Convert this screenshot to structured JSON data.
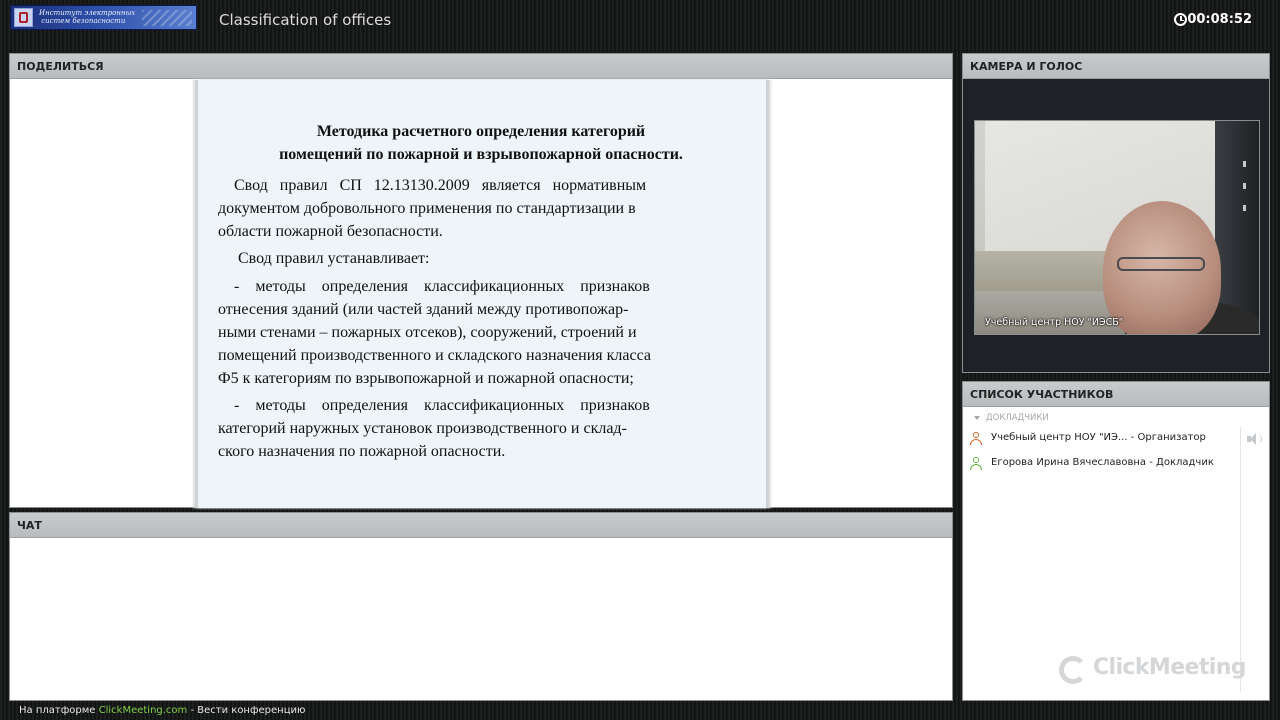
{
  "header": {
    "logo_text": "Институт электронных\n систем безопасности",
    "title": "Classification of offices",
    "timer": "00:08:52"
  },
  "share_panel": {
    "title": "ПОДЕЛИТЬСЯ",
    "slide": {
      "heading": "Методика расчетного определения категорий\nпомещений по пожарной и взрывопожарной опасности.",
      "paragraphs": [
        "    Свод   правил   СП   12.13130.2009   является   нормативным\nдокументом добровольного применения по стандартизации в\nобласти пожарной безопасности.",
        "     Свод правил устанавливает:",
        "    -    методы    определения    классификационных    признаков\nотнесения зданий (или частей зданий между противопожар-\nными стенами – пожарных отсеков), сооружений, строений и\nпомещений производственного и складского назначения класса\nФ5 к категориям по взрывопожарной и пожарной опасности;",
        "    -    методы    определения    классификационных    признаков\nкатегорий наружных установок производственного и склад-\nского назначения по пожарной опасности."
      ]
    }
  },
  "chat_panel": {
    "title": "ЧАТ"
  },
  "camera_panel": {
    "title": "КАМЕРА И ГОЛОС",
    "video_label": "Учебный центр НОУ \"ИЭСБ\""
  },
  "participants_panel": {
    "title": "СПИСОК УЧАСТНИКОВ",
    "section_label": "ДОКЛАДЧИКИ",
    "participants": [
      {
        "name": "Учебный центр НОУ \"ИЭ...  - Организатор",
        "role_icon": "organizer-user-icon",
        "color": "#e0672a"
      },
      {
        "name": "Егорова Ирина Вячеславовна - Докладчик",
        "role_icon": "speaker-user-icon",
        "color": "#62b33c"
      }
    ],
    "brand": "ClickMeeting"
  },
  "footer": {
    "prefix": "На платформе ",
    "link": "ClickMeeting.com",
    "suffix": " - Вести конференцию"
  }
}
